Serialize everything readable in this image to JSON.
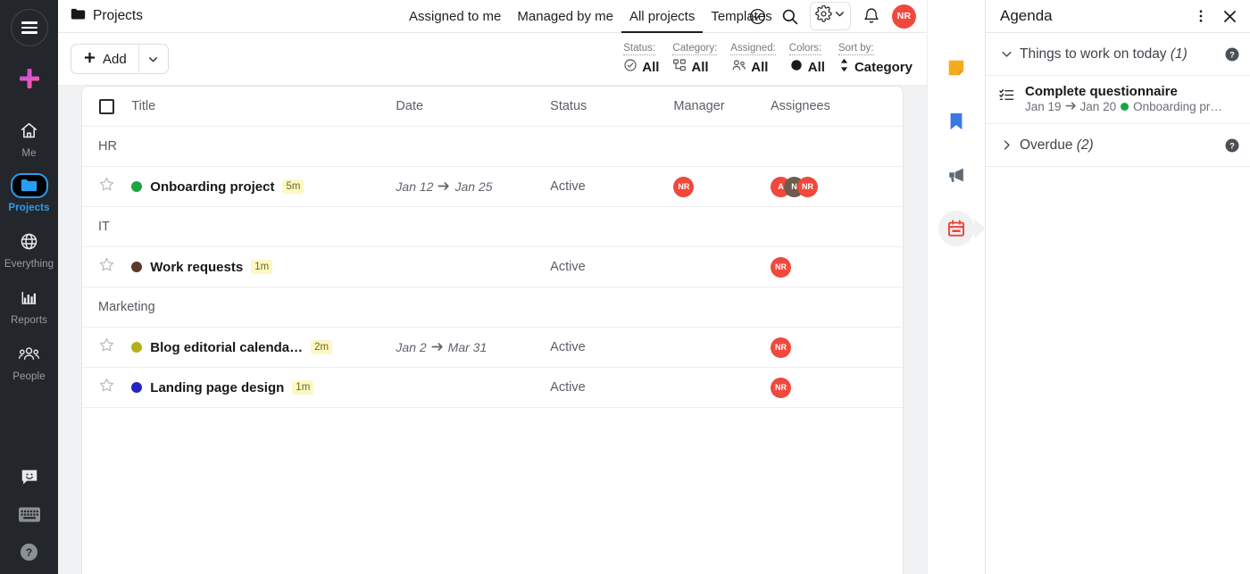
{
  "rail": {
    "menu_icon": "hamburger-icon",
    "add_icon": "plus-icon",
    "items": [
      {
        "label": "Me",
        "icon": "home-icon",
        "active": false
      },
      {
        "label": "Projects",
        "icon": "folder-icon",
        "active": true
      },
      {
        "label": "Everything",
        "icon": "globe-icon",
        "active": false
      },
      {
        "label": "Reports",
        "icon": "bar-chart-icon",
        "active": false
      },
      {
        "label": "People",
        "icon": "people-icon",
        "active": false
      }
    ],
    "bottom_icons": [
      "chat-smiley-icon",
      "keyboard-icon",
      "help-circle-icon"
    ]
  },
  "topbar": {
    "breadcrumb": "Projects",
    "breadcrumb_icon": "folder-icon",
    "nav": [
      {
        "label": "Assigned to me",
        "selected": false
      },
      {
        "label": "Managed by me",
        "selected": false
      },
      {
        "label": "All projects",
        "selected": true
      },
      {
        "label": "Templates",
        "selected": false
      }
    ],
    "actions": [
      "clock-check-icon",
      "search-icon",
      "gear-icon",
      "chevron-down-icon",
      "bell-icon"
    ],
    "avatar_initials": "NR",
    "avatar_color": "#f0483c"
  },
  "toolbar": {
    "add_label": "Add",
    "add_icon": "plus-icon",
    "add_dropdown_icon": "chevron-down-icon",
    "filters": [
      {
        "key": "Status:",
        "value": "All",
        "icon": "check-circle-icon"
      },
      {
        "key": "Category:",
        "value": "All",
        "icon": "hierarchy-icon"
      },
      {
        "key": "Assigned:",
        "value": "All",
        "icon": "people-icon"
      },
      {
        "key": "Colors:",
        "value": "All",
        "icon": "filled-circle-icon"
      },
      {
        "key": "Sort by:",
        "value": "Category",
        "icon": "sort-updown-icon"
      }
    ]
  },
  "table": {
    "columns": [
      "Title",
      "Date",
      "Status",
      "Manager",
      "Assignees"
    ],
    "select_all_checked": false,
    "groups": [
      {
        "name": "HR",
        "rows": [
          {
            "title": "Onboarding project",
            "badge": "5m",
            "color": "#1aa640",
            "date_start": "Jan 12",
            "date_end": "Jan 25",
            "status": "Active",
            "manager": [
              {
                "initials": "NR",
                "color": "#f0483c"
              }
            ],
            "assignees": [
              {
                "initials": "A",
                "color": "#f0483c"
              },
              {
                "initials": "N",
                "color": "#6f5b4c"
              },
              {
                "initials": "NR",
                "color": "#f0483c"
              }
            ],
            "starred": false
          }
        ]
      },
      {
        "name": "IT",
        "rows": [
          {
            "title": "Work requests",
            "badge": "1m",
            "color": "#5b3a29",
            "date_start": "",
            "date_end": "",
            "status": "Active",
            "manager": [],
            "assignees": [
              {
                "initials": "NR",
                "color": "#f0483c"
              }
            ],
            "starred": false
          }
        ]
      },
      {
        "name": "Marketing",
        "rows": [
          {
            "title": "Blog editorial calenda…",
            "badge": "2m",
            "color": "#b5b019",
            "date_start": "Jan 2",
            "date_end": "Mar 31",
            "status": "Active",
            "manager": [],
            "assignees": [
              {
                "initials": "NR",
                "color": "#f0483c"
              }
            ],
            "starred": false
          },
          {
            "title": "Landing page design",
            "badge": "1m",
            "color": "#2323c4",
            "date_start": "",
            "date_end": "",
            "status": "Active",
            "manager": [],
            "assignees": [
              {
                "initials": "NR",
                "color": "#f0483c"
              }
            ],
            "starred": false
          }
        ]
      }
    ]
  },
  "strip": {
    "icons": [
      {
        "name": "sticky-note-icon",
        "color": "#f5ab20",
        "active": false
      },
      {
        "name": "bookmark-icon",
        "color": "#3b78e7",
        "active": false
      },
      {
        "name": "megaphone-icon",
        "color": "#5f6b74",
        "active": false
      },
      {
        "name": "calendar-icon",
        "color": "#f04336",
        "active": true
      }
    ]
  },
  "agenda": {
    "title": "Agenda",
    "more_icon": "kebab-menu-icon",
    "close_icon": "close-icon",
    "sections": [
      {
        "label": "Things to work on today",
        "count": "(1)",
        "expanded": true,
        "help_icon": "help-circle-icon"
      },
      {
        "label": "Overdue",
        "count": "(2)",
        "expanded": false,
        "help_icon": "help-circle-icon"
      }
    ],
    "tasks": [
      {
        "icon": "checklist-icon",
        "title": "Complete questionnaire",
        "date_start": "Jan 19",
        "date_end": "Jan 20",
        "project": "Onboarding pr…",
        "project_color": "#1aa640"
      }
    ]
  }
}
